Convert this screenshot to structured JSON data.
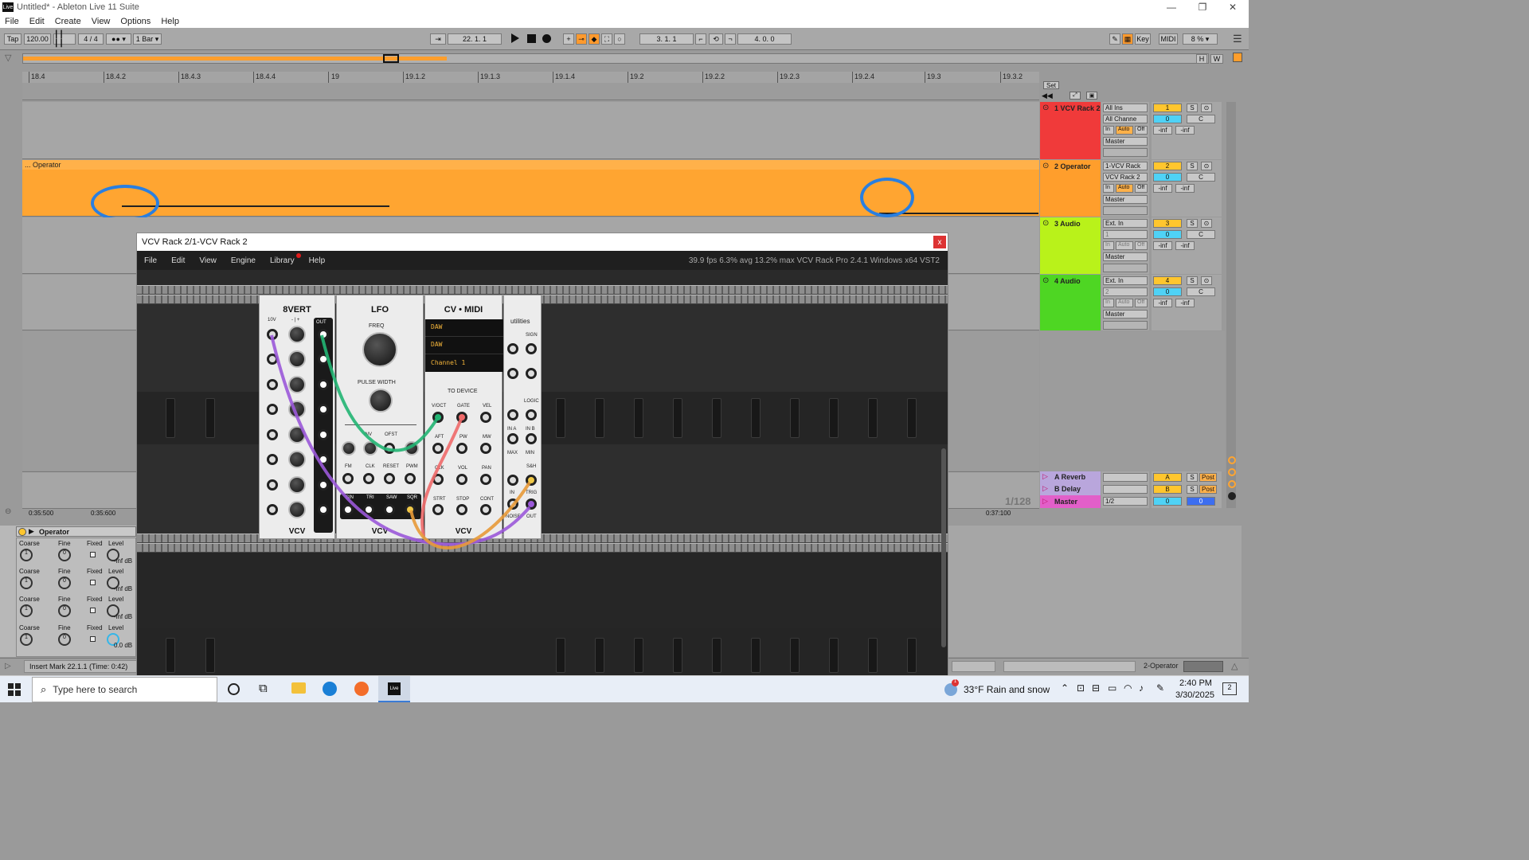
{
  "window": {
    "title": "Untitled* - Ableton Live 11 Suite",
    "logo_text": "Live",
    "minimize_icon": "—",
    "restore_icon": "❐",
    "close_icon": "✕"
  },
  "menu": [
    "File",
    "Edit",
    "Create",
    "View",
    "Options",
    "Help"
  ],
  "transport": {
    "tap": "Tap",
    "tempo": "120.00",
    "meter": "4 / 4",
    "quantize": "1 Bar",
    "position": "22.  1.  1",
    "loop_start": "3.  1.  1",
    "loop_length": "4.  0.  0",
    "key": "Key",
    "midi": "MIDI",
    "cpu": "8 %"
  },
  "overview_buttons": {
    "h": "H",
    "w": "W"
  },
  "ruler_marks": [
    "18.4",
    "18.4.2",
    "18.4.3",
    "18.4.4",
    "19",
    "19.1.2",
    "19.1.3",
    "19.1.4",
    "19.2",
    "19.2.2",
    "19.2.3",
    "19.2.4",
    "19.3",
    "19.3.2"
  ],
  "set_label": "Set",
  "clip_name": "... Operator",
  "tracks": [
    {
      "name": "1 VCV Rack 2",
      "color": "#f03a3a",
      "input": "All Ins",
      "channel": "All Channe",
      "out": "Master",
      "num": "1",
      "vol": "0",
      "pan": "C",
      "in": "In",
      "auto": "Auto",
      "off": "Off",
      "inf1": "-inf",
      "inf2": "-inf",
      "s": "S"
    },
    {
      "name": "2 Operator",
      "color": "#ff9e2c",
      "input": "1-VCV Rack",
      "channel": "VCV Rack 2",
      "out": "Master",
      "num": "2",
      "vol": "0",
      "pan": "C",
      "in": "In",
      "auto": "Auto",
      "off": "Off",
      "inf1": "-inf",
      "inf2": "-inf",
      "s": "S"
    },
    {
      "name": "3 Audio",
      "color": "#b9f21a",
      "input": "Ext. In",
      "channel": "1",
      "out": "Master",
      "num": "3",
      "vol": "0",
      "pan": "C",
      "in": "In",
      "auto": "Auto",
      "off": "Off",
      "inf1": "-inf",
      "inf2": "-inf",
      "s": "S"
    },
    {
      "name": "4 Audio",
      "color": "#4ed623",
      "input": "Ext. In",
      "channel": "2",
      "out": "Master",
      "num": "4",
      "vol": "0",
      "pan": "C",
      "in": "In",
      "auto": "Auto",
      "off": "Off",
      "inf1": "-inf",
      "inf2": "-inf",
      "s": "S"
    }
  ],
  "returns": [
    {
      "name": "A Reverb",
      "letter": "A",
      "s": "S",
      "post": "Post"
    },
    {
      "name": "B Delay",
      "letter": "B",
      "s": "S",
      "post": "Post"
    },
    {
      "name": "Master",
      "input": "1/2",
      "vol": "0",
      "pan": "0"
    }
  ],
  "time_labels": {
    "a": "0:35:500",
    "b": "0:35:600",
    "c": "0:37:100",
    "zoom": "1/128"
  },
  "vcv": {
    "title": "VCV Rack 2/1-VCV Rack 2",
    "close": "x",
    "menu": [
      "File",
      "Edit",
      "View",
      "Engine",
      "Library",
      "Help"
    ],
    "stats": "39.9 fps  6.3% avg  13.2% max     VCV Rack Pro 2.4.1 Windows x64 VST2",
    "brand": "VCV",
    "modules": {
      "vert": {
        "title": "8VERT",
        "label_10v": "10V",
        "label_pm": "- | +",
        "out": "OUT"
      },
      "lfo": {
        "title": "LFO",
        "freq": "FREQ",
        "pulse": "PULSE WIDTH",
        "inv": "INV",
        "ofst": "OFST",
        "fm": "FM",
        "clk": "CLK",
        "reset": "RESET",
        "pwm": "PWM",
        "sin": "SIN",
        "tri": "TRI",
        "saw": "SAW",
        "sqr": "SQR"
      },
      "cvmidi": {
        "title": "CV • MIDI",
        "driver": "DAW",
        "device": "DAW",
        "channel": "Channel 1",
        "to_device": "TO DEVICE",
        "voct": "V/OCT",
        "gate": "GATE",
        "vel": "VEL",
        "aft": "AFT",
        "pw": "PW",
        "mw": "MW",
        "clk": "CLK",
        "vol": "VOL",
        "pan": "PAN",
        "strt": "STRT",
        "stop": "STOP",
        "cont": "CONT"
      },
      "util": {
        "title": "utilities",
        "sign": "SIGN",
        "logic": "LOGIC",
        "in_a": "IN A",
        "in_b": "IN B",
        "max": "MAX",
        "min": "MIN",
        "sh": "S&H",
        "in": "IN",
        "trig": "TRIG",
        "noise": "NOISE",
        "out": "OUT"
      }
    }
  },
  "device": {
    "name": "Operator",
    "rows": [
      {
        "coarse": "Coarse",
        "fine": "Fine",
        "fixed": "Fixed",
        "level": "Level",
        "cval": "1",
        "fval": "0",
        "lval": "-inf dB"
      },
      {
        "coarse": "Coarse",
        "fine": "Fine",
        "fixed": "Fixed",
        "level": "Level",
        "cval": "1",
        "fval": "0",
        "lval": "-inf dB"
      },
      {
        "coarse": "Coarse",
        "fine": "Fine",
        "fixed": "Fixed",
        "level": "Level",
        "cval": "1",
        "fval": "0",
        "lval": "-inf dB"
      },
      {
        "coarse": "Coarse",
        "fine": "Fine",
        "fixed": "Fixed",
        "level": "Level",
        "cval": "1",
        "fval": "0",
        "lval": "0.0 dB"
      }
    ]
  },
  "status": {
    "message": "Insert Mark 22.1.1 (Time: 0:42)",
    "track": "2-Operator"
  },
  "taskbar": {
    "search_placeholder": "Type here to search",
    "weather": "33°F  Rain and snow",
    "time": "2:40 PM",
    "date": "3/30/2025",
    "notif_count": "2",
    "live_icon_text": "Live"
  }
}
